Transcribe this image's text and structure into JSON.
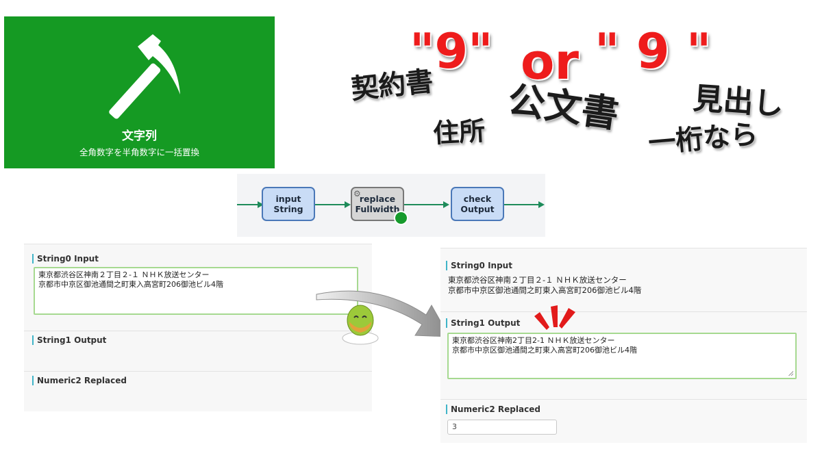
{
  "tile": {
    "title": "文字列",
    "subtitle": "全角数字を半角数字に一括置換",
    "bg_color": "#159a23",
    "icon": "hammer-icon"
  },
  "keywords": {
    "contract": "契約書",
    "nine_a": "\"9\"",
    "or": "or",
    "nine_b": "\" 9 \"",
    "heading": "見出し",
    "address": "住所",
    "official": "公文書",
    "single_digit": "一桁なら",
    "accent_color": "#ee1c1c"
  },
  "flow": {
    "nodes": [
      {
        "line1": "input",
        "line2": "String"
      },
      {
        "line1": "replace",
        "line2": "Fullwidth"
      },
      {
        "line1": "check",
        "line2": "Output"
      }
    ],
    "line_color": "#1e8b5a"
  },
  "before": {
    "string0_label": "String0 Input",
    "string0_line1": "東京都渋谷区神南２丁目２-１ ＮＨＫ放送センター",
    "string0_line2": "京都市中京区御池通間之町東入高宮町206御池ビル4階",
    "string1_label": "String1 Output",
    "numeric2_label": "Numeric2 Replaced"
  },
  "after": {
    "string0_label": "String0 Input",
    "string0_line1": "東京都渋谷区神南２丁目２-１ ＮＨＫ放送センター",
    "string0_line2": "京都市中京区御池通間之町東入高宮町206御池ビル4階",
    "string1_label": "String1 Output",
    "string1_line1": "東京都渋谷区神南2丁目2-1 ＮＨＫ放送センター",
    "string1_line2": "京都市中京区御池通間之町東入高宮町206御池ビル4階",
    "numeric2_label": "Numeric2 Replaced",
    "numeric2_value": "3"
  }
}
